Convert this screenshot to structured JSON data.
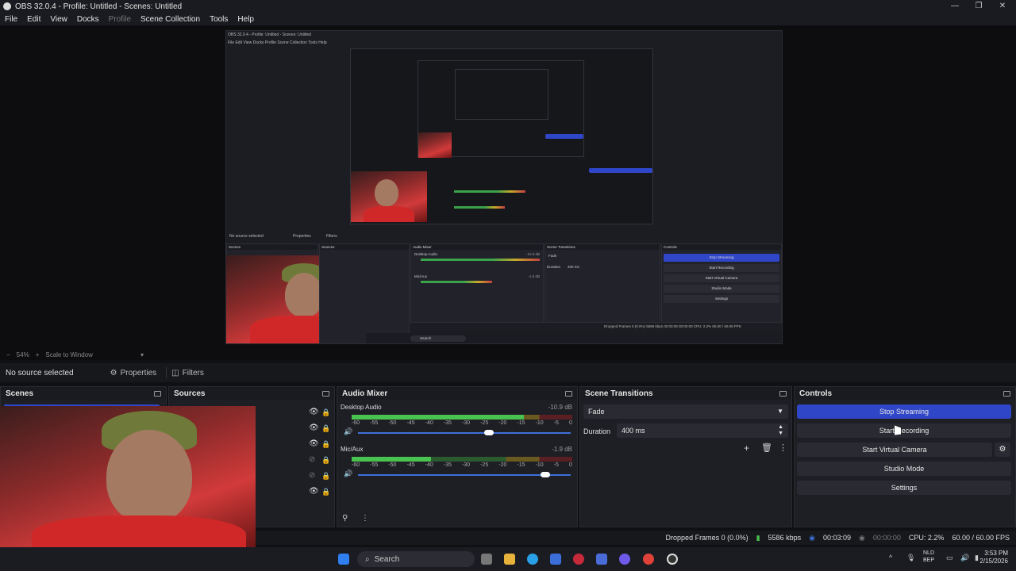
{
  "window": {
    "title": "OBS 32.0.4 - Profile: Untitled - Scenes: Untitled",
    "minimize": "—",
    "maximize": "❐",
    "close": "✕"
  },
  "menu": [
    "File",
    "Edit",
    "View",
    "Docks",
    "Profile",
    "Scene Collection",
    "Tools",
    "Help"
  ],
  "preview": {
    "zoom": "54%",
    "minus": "−",
    "plus": "+",
    "scale_mode": "Scale to Window",
    "nested_title": "OBS 32.0.4 - Profile: Untitled - Scenes: Untitled",
    "nested_menu": "File  Edit  View  Docks  Profile  Scene Collection  Tools  Help",
    "nested_no_source": "No source selected",
    "nested_properties": "Properties",
    "nested_filters": "Filters",
    "nested_docks": {
      "scenes": "Scenes",
      "sources": "Sources",
      "audio_mixer": "Audio Mixer",
      "scene_transitions": "Scene Transitions",
      "controls": "Controls"
    },
    "nested_mixer": {
      "ch1": "Desktop Audio",
      "ch1_db": "-10.9 dB",
      "ch2": "Mic/Aux",
      "ch2_db": "-1.9 dB"
    },
    "nested_transition": "Fade",
    "nested_duration_label": "Duration",
    "nested_duration": "400 ms",
    "nested_controls": [
      "Stop Streaming",
      "Start Recording",
      "Start Virtual Camera",
      "Studio Mode",
      "Settings"
    ],
    "nested_status": "Dropped Frames 0 (0.0%)  5586 kbps  00:03:09  00:00:00  CPU: 2.2%  60.00 / 60.00 FPS",
    "nested_search": "Search",
    "nested_clock": "3:53 PM\n2/15/2026"
  },
  "context_bar": {
    "no_source": "No source selected",
    "properties": "Properties",
    "filters": "Filters"
  },
  "docks": {
    "scenes": {
      "title": "Scenes"
    },
    "sources": {
      "title": "Sources"
    },
    "audio_mixer": {
      "title": "Audio Mixer",
      "channels": [
        {
          "name": "Desktop Audio",
          "db": "-10.9 dB",
          "level": 0.78,
          "volume": 0.62
        },
        {
          "name": "Mic/Aux",
          "db": "-1.9 dB",
          "level": 0.36,
          "volume": 0.9
        }
      ],
      "ticks": [
        "-60",
        "-55",
        "-50",
        "-45",
        "-40",
        "-35",
        "-30",
        "-25",
        "-20",
        "-15",
        "-10",
        "-5",
        "0"
      ]
    },
    "scene_transitions": {
      "title": "Scene Transitions",
      "transition": "Fade",
      "duration_label": "Duration",
      "duration": "400 ms"
    },
    "controls": {
      "title": "Controls",
      "buttons": [
        "Stop Streaming",
        "Start Recording",
        "Start Virtual Camera",
        "Studio Mode",
        "Settings"
      ]
    }
  },
  "status": {
    "dropped": "Dropped Frames 0 (0.0%)",
    "bitrate": "5586 kbps",
    "stream_time": "00:03:09",
    "rec_time": "00:00:00",
    "cpu": "CPU: 2.2%",
    "fps": "60.00 / 60.00 FPS"
  },
  "taskbar": {
    "search": "Search",
    "lang": "NLD\nBEP",
    "time": "3:53 PM",
    "date": "2/15/2026"
  },
  "colors": {
    "accent": "#2f46c8",
    "panel": "#1e1f25",
    "bg": "#0f1014"
  }
}
